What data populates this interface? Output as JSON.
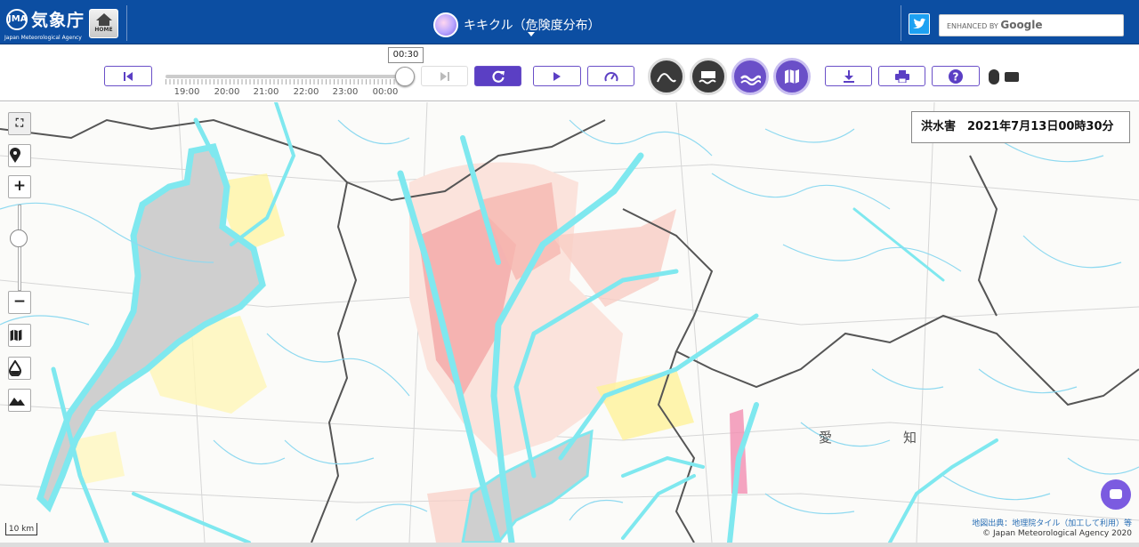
{
  "header": {
    "logo_ja": "気象庁",
    "logo_en": "Japan Meteorological Agency",
    "home_label": "HOME",
    "title": "キキクル（危険度分布）",
    "search_prefix": "ENHANCED BY",
    "search_brand": "Google",
    "colors": {
      "bar": "#0c4ea2",
      "accent": "#5b3fc4"
    }
  },
  "toolbar": {
    "current_time": "00:30",
    "time_labels": [
      "19:00",
      "20:00",
      "21:00",
      "22:00",
      "23:00",
      "00:00"
    ],
    "slider_value": 1.0,
    "icons": {
      "first": "skip-to-start-icon",
      "last": "skip-to-end-icon",
      "refresh": "refresh-icon",
      "play": "play-icon",
      "speed": "speedometer-icon",
      "download": "download-icon",
      "print": "printer-icon",
      "help": "help-icon"
    },
    "layers": [
      "landslide-layer",
      "inundation-layer",
      "flood-layer",
      "map-layer"
    ],
    "active_layer": "flood-layer"
  },
  "map": {
    "panel_text": "洪水害　2021年7月13日00時30分",
    "attribution_link": "地図出典：地理院タイル（加工して利用）等",
    "copyright": "© Japan Meteorological Agency 2020",
    "scale_label": "10 km",
    "controls": [
      "fullscreen-icon",
      "location-pin-icon",
      "zoom-in",
      "zoom-out",
      "map-icon",
      "water-drop-icon",
      "terrain-icon"
    ],
    "labels": {
      "ai": "愛",
      "chi": "知"
    },
    "colors": {
      "river": "#7fe8ef",
      "lake": "#cfcfcf",
      "warning": "#f4a6a6",
      "caution": "#fff39a"
    }
  }
}
